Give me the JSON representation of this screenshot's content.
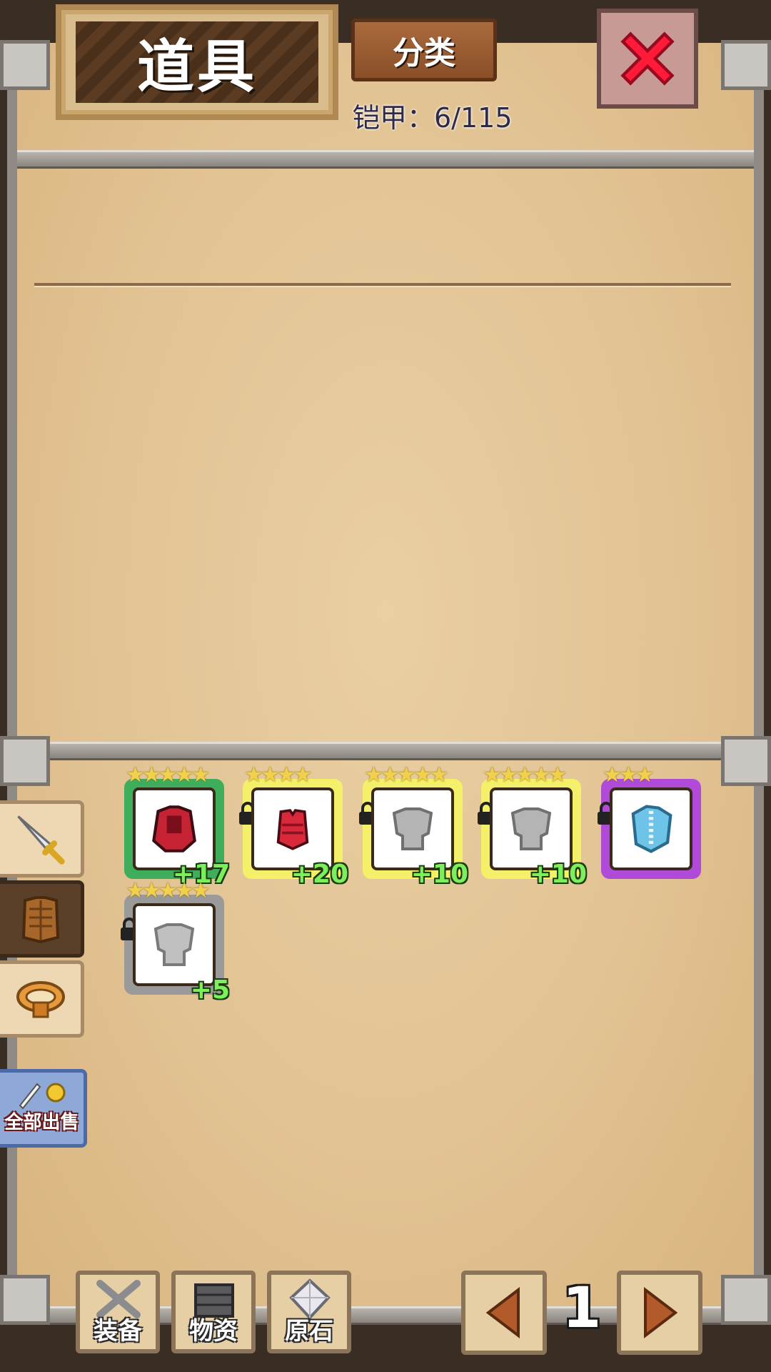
{
  "header": {
    "title": "道具",
    "sort_label": "分类",
    "count_label": "铠甲：6/115"
  },
  "items": [
    {
      "stars": "★★★★★",
      "plus": "+17",
      "rarity_color": "#3fae5c",
      "icon": "red-armor-icon",
      "locked": false
    },
    {
      "stars": "★★★★",
      "plus": "+20",
      "rarity_color": "#f4f06a",
      "icon": "red-vest-icon",
      "locked": true
    },
    {
      "stars": "★★★★★",
      "plus": "+10",
      "rarity_color": "#f4f06a",
      "icon": "gray-armor-icon",
      "locked": true
    },
    {
      "stars": "★★★★★",
      "plus": "+10",
      "rarity_color": "#f4f06a",
      "icon": "gray-armor-icon",
      "locked": true
    },
    {
      "stars": "★★★",
      "plus": "",
      "rarity_color": "#b04ad8",
      "icon": "blue-armor-icon",
      "locked": true
    },
    {
      "stars": "★★★★★",
      "plus": "+5",
      "rarity_color": "#9a9a9a",
      "icon": "gray-armor-icon",
      "locked": true
    }
  ],
  "side_tabs": [
    {
      "name": "weapon",
      "icon": "sword-icon"
    },
    {
      "name": "armor",
      "icon": "armor-icon",
      "active": true
    },
    {
      "name": "accessory",
      "icon": "ring-icon"
    }
  ],
  "sell_all_label": "全部出售",
  "bottom_nav": {
    "equip_label": "装备",
    "supplies_label": "物资",
    "ore_label": "原石"
  },
  "pagination": {
    "current_page": "1"
  }
}
